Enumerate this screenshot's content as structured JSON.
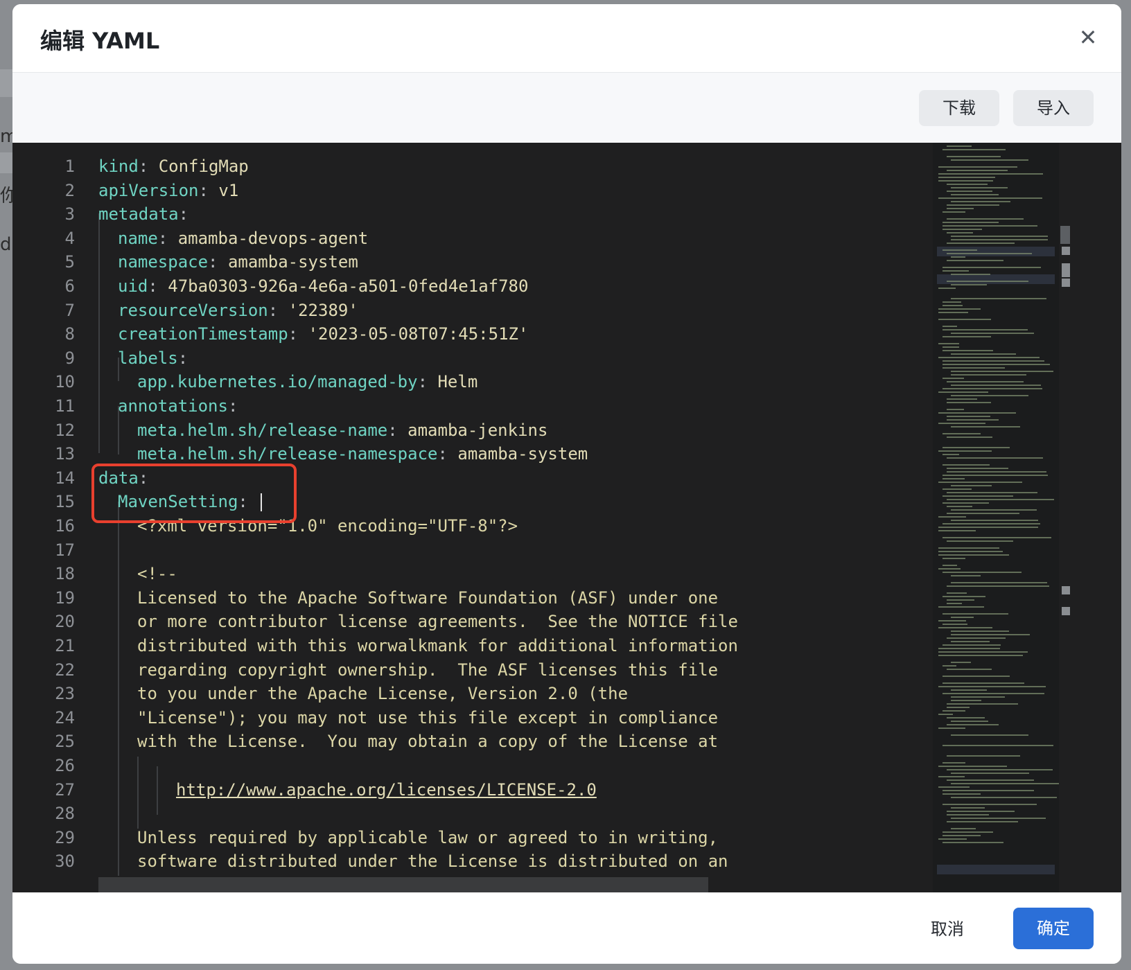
{
  "modal": {
    "title": "编辑 YAML",
    "close_label": "✕"
  },
  "toolbar": {
    "download_label": "下载",
    "import_label": "导入"
  },
  "footer": {
    "cancel_label": "取消",
    "ok_label": "确定"
  },
  "background": {
    "fragments": [
      "m",
      "你",
      "d"
    ]
  },
  "editor": {
    "line_numbers": [
      "1",
      "2",
      "3",
      "4",
      "5",
      "6",
      "7",
      "8",
      "9",
      "10",
      "11",
      "12",
      "13",
      "14",
      "15",
      "16",
      "17",
      "18",
      "19",
      "20",
      "21",
      "22",
      "23",
      "24",
      "25",
      "26",
      "27",
      "28",
      "29",
      "30"
    ],
    "lines": [
      {
        "key": "kind",
        "sep": ": ",
        "val": "ConfigMap"
      },
      {
        "key": "apiVersion",
        "sep": ": ",
        "val": "v1"
      },
      {
        "key": "metadata",
        "sep": ":",
        "val": ""
      },
      {
        "key": "name",
        "sep": ": ",
        "val": "amamba-devops-agent"
      },
      {
        "key": "namespace",
        "sep": ": ",
        "val": "amamba-system"
      },
      {
        "key": "uid",
        "sep": ": ",
        "val": "47ba0303-926a-4e6a-a501-0fed4e1af780"
      },
      {
        "key": "resourceVersion",
        "sep": ": ",
        "val": "'22389'"
      },
      {
        "key": "creationTimestamp",
        "sep": ": ",
        "val": "'2023-05-08T07:45:51Z'"
      },
      {
        "key": "labels",
        "sep": ":",
        "val": ""
      },
      {
        "key": "app.kubernetes.io/managed-by",
        "sep": ": ",
        "val": "Helm"
      },
      {
        "key": "annotations",
        "sep": ":",
        "val": ""
      },
      {
        "key": "meta.helm.sh/release-name",
        "sep": ": ",
        "val": "amamba-jenkins"
      },
      {
        "key": "meta.helm.sh/release-namespace",
        "sep": ": ",
        "val": "amamba-system"
      },
      {
        "key": "data",
        "sep": ":",
        "val": ""
      },
      {
        "key": "MavenSetting",
        "sep": ": ",
        "val": ""
      },
      {
        "text": "<?xml version=\"1.0\" encoding=\"UTF-8\"?>"
      },
      {
        "text": ""
      },
      {
        "text": "<!--"
      },
      {
        "text": "Licensed to the Apache Software Foundation (ASF) under one"
      },
      {
        "text": "or more contributor license agreements.  See the NOTICE file"
      },
      {
        "text": "distributed with this worwalkmank for additional information"
      },
      {
        "text": "regarding copyright ownership.  The ASF licenses this file"
      },
      {
        "text": "to you under the Apache License, Version 2.0 (the"
      },
      {
        "text": "\"License\"); you may not use this file except in compliance"
      },
      {
        "text": "with the License.  You may obtain a copy of the License at"
      },
      {
        "text": ""
      },
      {
        "text": "http://www.apache.org/licenses/LICENSE-2.0"
      },
      {
        "text": ""
      },
      {
        "text": "Unless required by applicable law or agreed to in writing,"
      },
      {
        "text": "software distributed under the License is distributed on an"
      }
    ]
  },
  "colors": {
    "accent": "#2b6fd8",
    "editor_bg": "#1f1f20",
    "yaml_key": "#6fd4c3",
    "yaml_value": "#e2dcb6",
    "highlight_border": "#e8402e"
  }
}
